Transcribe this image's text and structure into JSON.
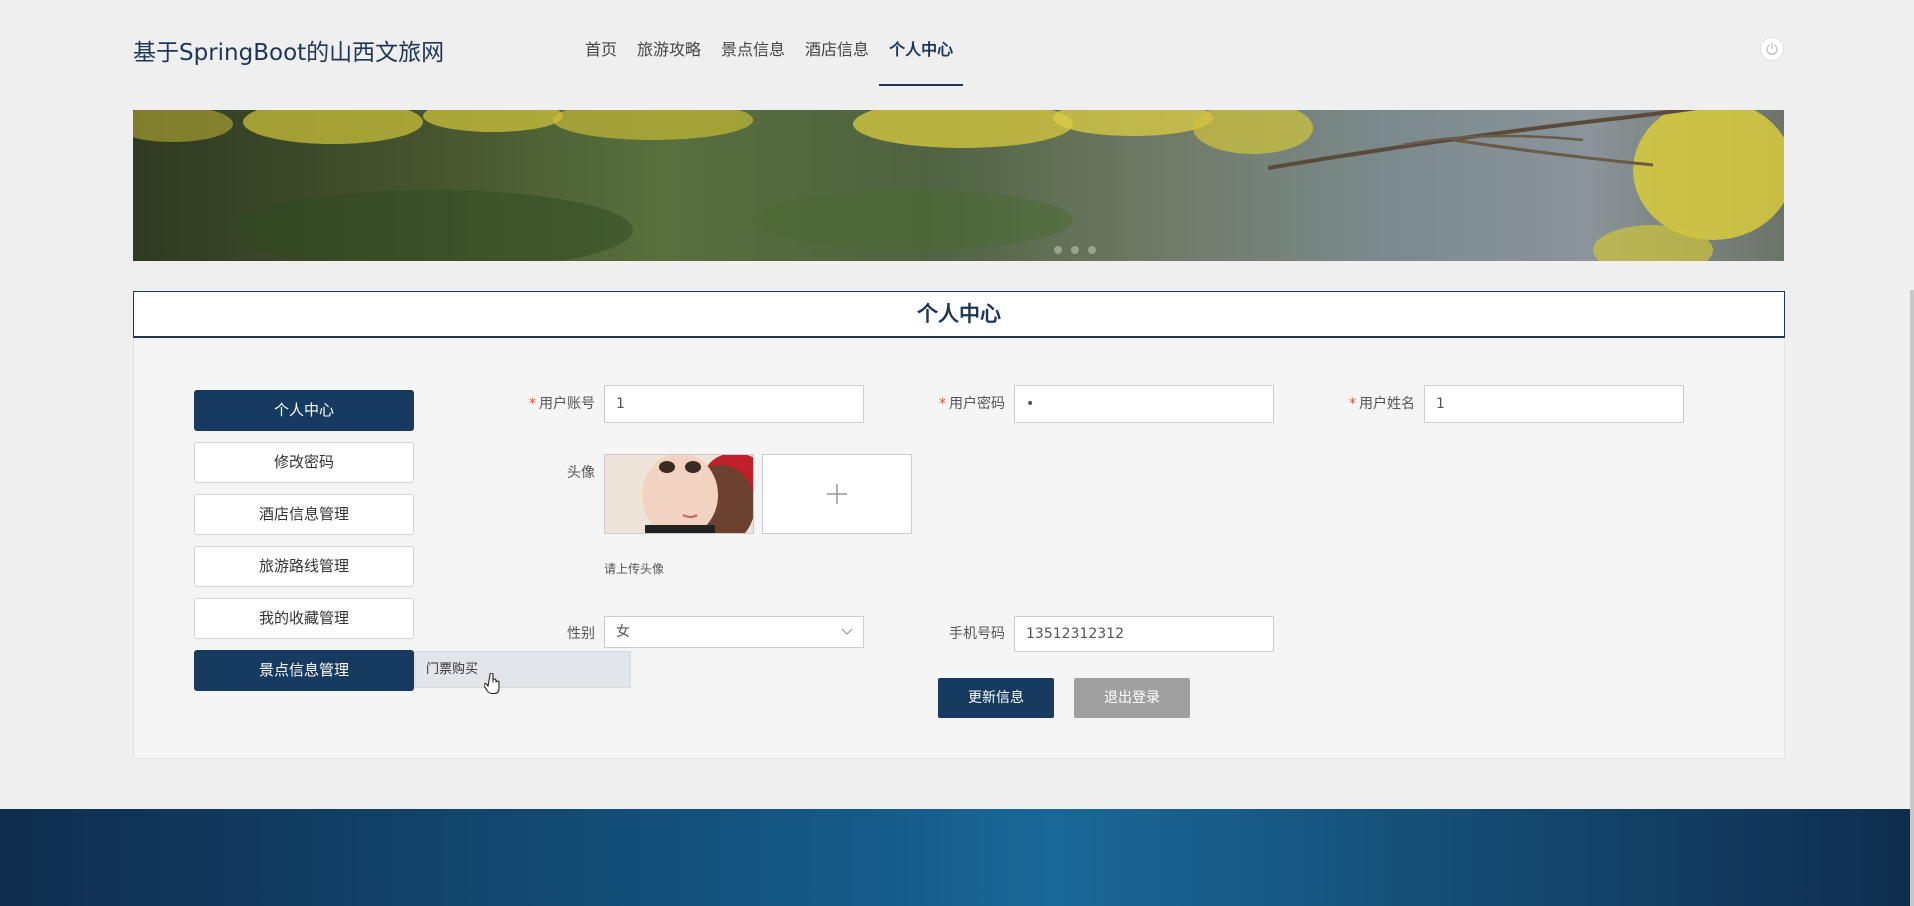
{
  "header": {
    "site_title": "基于SpringBoot的山西文旅网",
    "nav": [
      "首页",
      "旅游攻略",
      "景点信息",
      "酒店信息",
      "个人中心"
    ],
    "active_nav": "个人中心",
    "power_icon": "power-icon"
  },
  "banner": {
    "dot_count": 3,
    "active_dot": 0
  },
  "panel": {
    "title": "个人中心"
  },
  "menu": {
    "items": [
      "个人中心",
      "修改密码",
      "酒店信息管理",
      "旅游路线管理",
      "我的收藏管理",
      "景点信息管理"
    ],
    "submenu_item": "门票购买"
  },
  "form": {
    "username_label": "用户账号",
    "username_value": "1",
    "password_label": "用户密码",
    "password_value": "•",
    "name_label": "用户姓名",
    "name_value": "1",
    "avatar_label": "头像",
    "avatar_hint": "请上传头像",
    "gender_label": "性别",
    "gender_value": "女",
    "phone_label": "手机号码",
    "phone_value": "13512312312",
    "update_button": "更新信息",
    "logout_button": "退出登录"
  },
  "colors": {
    "primary": "#173a60",
    "required": "#e74c3c",
    "logout": "#a0a0a0"
  }
}
